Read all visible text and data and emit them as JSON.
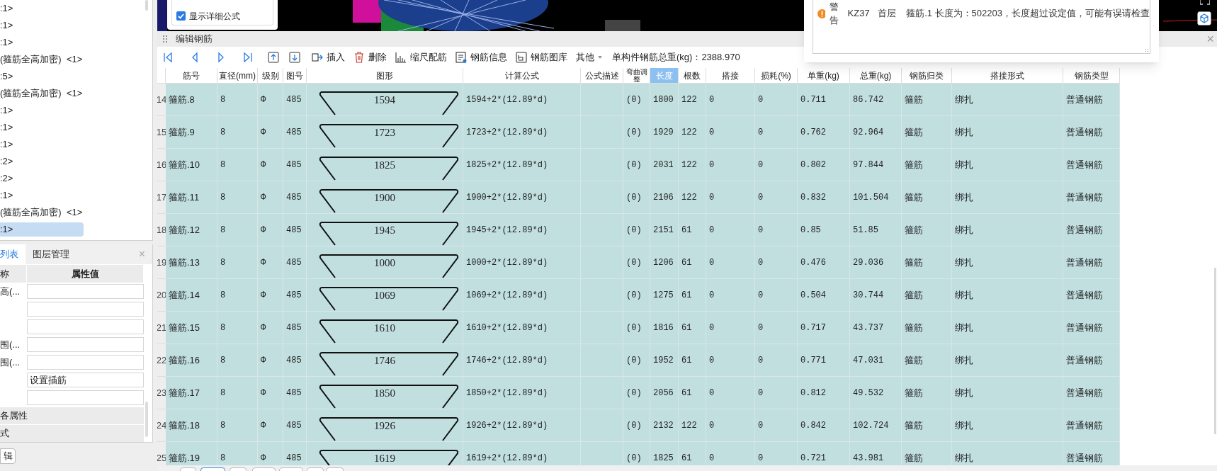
{
  "tree": {
    "items": [
      {
        "label": ":1>",
        "selected": false
      },
      {
        "label": ":1>",
        "selected": false
      },
      {
        "label": ":1>",
        "selected": false
      },
      {
        "label": "(箍筋全高加密)  <1>",
        "selected": false
      },
      {
        "label": ":5>",
        "selected": false
      },
      {
        "label": "(箍筋全高加密)  <1>",
        "selected": false
      },
      {
        "label": ":1>",
        "selected": false
      },
      {
        "label": ":1>",
        "selected": false
      },
      {
        "label": ":1>",
        "selected": false
      },
      {
        "label": ":2>",
        "selected": false
      },
      {
        "label": ":2>",
        "selected": false
      },
      {
        "label": ":1>",
        "selected": false
      },
      {
        "label": "(箍筋全高加密)  <1>",
        "selected": false
      },
      {
        "label": ":1>",
        "selected": true
      }
    ]
  },
  "properties_panel": {
    "tabs": [
      {
        "label": "列表",
        "selected": true
      },
      {
        "label": "图层管理",
        "selected": false
      }
    ],
    "close": "×",
    "columns": [
      "称",
      "属性值"
    ],
    "rows": [
      {
        "name": "高(..."
      },
      {},
      {},
      {
        "name": "围(..."
      },
      {
        "name": "围(..."
      },
      {
        "value": "设置插筋"
      },
      {}
    ],
    "groups": [
      "各属性",
      "式"
    ]
  },
  "bottom_button": "辑",
  "display_options": [
    {
      "label": "显示详细公式",
      "checked": true
    }
  ],
  "warnings": [
    {
      "level": "警告",
      "component": "KZ37",
      "floor": "首层",
      "message": "箍筋.1 长度为：502203，长度超过设定值，可能有误请检查"
    }
  ],
  "rebar_editor": {
    "title": "编辑钢筋",
    "close": "×",
    "toolbar": [
      {
        "kind": "insert",
        "label": "插入"
      },
      {
        "kind": "delete",
        "label": "删除"
      },
      {
        "kind": "scale",
        "label": "缩尺配筋"
      },
      {
        "kind": "info",
        "label": "钢筋信息"
      },
      {
        "kind": "library",
        "label": "钢筋图库"
      },
      {
        "kind": "menu",
        "label": "其他"
      }
    ],
    "total_weight": "单构件钢筋总重(kg)：2388.970",
    "columns": [
      {
        "label": "筋号",
        "selected": false
      },
      {
        "label": "直径(mm)",
        "selected": false
      },
      {
        "label": "级别",
        "selected": false
      },
      {
        "label": "图号",
        "selected": false
      },
      {
        "label": "图形",
        "selected": false
      },
      {
        "label": "计算公式",
        "selected": false
      },
      {
        "label": "公式描述",
        "selected": false
      },
      {
        "label": "弯曲调整",
        "selected": false
      },
      {
        "label": "长度",
        "selected": true
      },
      {
        "label": "根数",
        "selected": false
      },
      {
        "label": "搭接",
        "selected": false
      },
      {
        "label": "损耗(%)",
        "selected": false
      },
      {
        "label": "单重(kg)",
        "selected": false
      },
      {
        "label": "总重(kg)",
        "selected": false
      },
      {
        "label": "钢筋归类",
        "selected": false
      },
      {
        "label": "搭接形式",
        "selected": false
      },
      {
        "label": "钢筋类型",
        "selected": false
      }
    ],
    "rows": [
      {
        "index": "14",
        "bar_no": "箍筋.8",
        "diameter": "8",
        "grade": "Φ",
        "figure_no": "485",
        "shape_length": "1594",
        "formula": "1594+2*(12.89*d)",
        "bend_adjust": "(0)",
        "length": "1800",
        "count": "122",
        "lap": "0",
        "loss": "0",
        "unit_weight": "0.711",
        "total_weight": "86.742",
        "category": "箍筋",
        "lap_type": "绑扎",
        "bar_type": "普通钢筋"
      },
      {
        "index": "15",
        "bar_no": "箍筋.9",
        "diameter": "8",
        "grade": "Φ",
        "figure_no": "485",
        "shape_length": "1723",
        "formula": "1723+2*(12.89*d)",
        "bend_adjust": "(0)",
        "length": "1929",
        "count": "122",
        "lap": "0",
        "loss": "0",
        "unit_weight": "0.762",
        "total_weight": "92.964",
        "category": "箍筋",
        "lap_type": "绑扎",
        "bar_type": "普通钢筋"
      },
      {
        "index": "16",
        "bar_no": "箍筋.10",
        "diameter": "8",
        "grade": "Φ",
        "figure_no": "485",
        "shape_length": "1825",
        "formula": "1825+2*(12.89*d)",
        "bend_adjust": "(0)",
        "length": "2031",
        "count": "122",
        "lap": "0",
        "loss": "0",
        "unit_weight": "0.802",
        "total_weight": "97.844",
        "category": "箍筋",
        "lap_type": "绑扎",
        "bar_type": "普通钢筋"
      },
      {
        "index": "17",
        "bar_no": "箍筋.11",
        "diameter": "8",
        "grade": "Φ",
        "figure_no": "485",
        "shape_length": "1900",
        "formula": "1900+2*(12.89*d)",
        "bend_adjust": "(0)",
        "length": "2106",
        "count": "122",
        "lap": "0",
        "loss": "0",
        "unit_weight": "0.832",
        "total_weight": "101.504",
        "category": "箍筋",
        "lap_type": "绑扎",
        "bar_type": "普通钢筋"
      },
      {
        "index": "18",
        "bar_no": "箍筋.12",
        "diameter": "8",
        "grade": "Φ",
        "figure_no": "485",
        "shape_length": "1945",
        "formula": "1945+2*(12.89*d)",
        "bend_adjust": "(0)",
        "length": "2151",
        "count": "61",
        "lap": "0",
        "loss": "0",
        "unit_weight": "0.85",
        "total_weight": "51.85",
        "category": "箍筋",
        "lap_type": "绑扎",
        "bar_type": "普通钢筋"
      },
      {
        "index": "19",
        "bar_no": "箍筋.13",
        "diameter": "8",
        "grade": "Φ",
        "figure_no": "485",
        "shape_length": "1000",
        "formula": "1000+2*(12.89*d)",
        "bend_adjust": "(0)",
        "length": "1206",
        "count": "61",
        "lap": "0",
        "loss": "0",
        "unit_weight": "0.476",
        "total_weight": "29.036",
        "category": "箍筋",
        "lap_type": "绑扎",
        "bar_type": "普通钢筋"
      },
      {
        "index": "20",
        "bar_no": "箍筋.14",
        "diameter": "8",
        "grade": "Φ",
        "figure_no": "485",
        "shape_length": "1069",
        "formula": "1069+2*(12.89*d)",
        "bend_adjust": "(0)",
        "length": "1275",
        "count": "61",
        "lap": "0",
        "loss": "0",
        "unit_weight": "0.504",
        "total_weight": "30.744",
        "category": "箍筋",
        "lap_type": "绑扎",
        "bar_type": "普通钢筋"
      },
      {
        "index": "21",
        "bar_no": "箍筋.15",
        "diameter": "8",
        "grade": "Φ",
        "figure_no": "485",
        "shape_length": "1610",
        "formula": "1610+2*(12.89*d)",
        "bend_adjust": "(0)",
        "length": "1816",
        "count": "61",
        "lap": "0",
        "loss": "0",
        "unit_weight": "0.717",
        "total_weight": "43.737",
        "category": "箍筋",
        "lap_type": "绑扎",
        "bar_type": "普通钢筋"
      },
      {
        "index": "22",
        "bar_no": "箍筋.16",
        "diameter": "8",
        "grade": "Φ",
        "figure_no": "485",
        "shape_length": "1746",
        "formula": "1746+2*(12.89*d)",
        "bend_adjust": "(0)",
        "length": "1952",
        "count": "61",
        "lap": "0",
        "loss": "0",
        "unit_weight": "0.771",
        "total_weight": "47.031",
        "category": "箍筋",
        "lap_type": "绑扎",
        "bar_type": "普通钢筋"
      },
      {
        "index": "23",
        "bar_no": "箍筋.17",
        "diameter": "8",
        "grade": "Φ",
        "figure_no": "485",
        "shape_length": "1850",
        "formula": "1850+2*(12.89*d)",
        "bend_adjust": "(0)",
        "length": "2056",
        "count": "61",
        "lap": "0",
        "loss": "0",
        "unit_weight": "0.812",
        "total_weight": "49.532",
        "category": "箍筋",
        "lap_type": "绑扎",
        "bar_type": "普通钢筋"
      },
      {
        "index": "24",
        "bar_no": "箍筋.18",
        "diameter": "8",
        "grade": "Φ",
        "figure_no": "485",
        "shape_length": "1926",
        "formula": "1926+2*(12.89*d)",
        "bend_adjust": "(0)",
        "length": "2132",
        "count": "122",
        "lap": "0",
        "loss": "0",
        "unit_weight": "0.842",
        "total_weight": "102.724",
        "category": "箍筋",
        "lap_type": "绑扎",
        "bar_type": "普通钢筋"
      },
      {
        "index": "25",
        "bar_no": "箍筋.19",
        "diameter": "8",
        "grade": "Φ",
        "figure_no": "485",
        "shape_length": "1619",
        "formula": "1619+2*(12.89*d)",
        "bend_adjust": "(0)",
        "length": "1825",
        "count": "61",
        "lap": "0",
        "loss": "0",
        "unit_weight": "0.721",
        "total_weight": "43.981",
        "category": "箍筋",
        "lap_type": "绑扎",
        "bar_type": "普通钢筋"
      }
    ]
  },
  "bottom_tabs": [
    {
      "selected": false
    },
    {
      "selected": true
    },
    {
      "selected": false
    },
    {
      "selected": false
    },
    {
      "selected": false
    },
    {
      "selected": false
    },
    {
      "selected": false
    }
  ]
}
